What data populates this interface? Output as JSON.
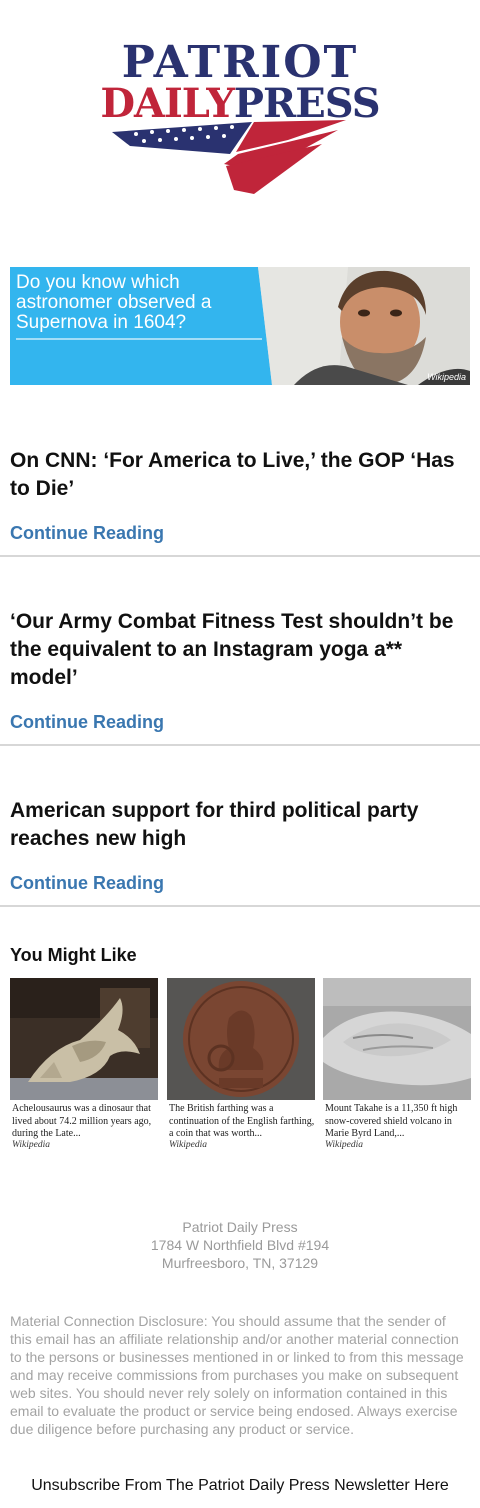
{
  "header": {
    "logo_line1": "PATRIOT",
    "logo_daily": "DAILY",
    "logo_press": "PRESS",
    "brand_colors": {
      "navy": "#2a3270",
      "red": "#c0253a"
    }
  },
  "ad": {
    "text": "Do you know which astronomer observed a Supernova in 1604?",
    "source": "Wikipedia",
    "background": "#33b5ee"
  },
  "articles": [
    {
      "title": "On CNN: ‘For America to Live,’ the GOP ‘Has to Die’",
      "cta": "Continue Reading"
    },
    {
      "title": "‘Our Army Combat Fitness Test shouldn’t be the equivalent to an Instagram yoga a** model’",
      "cta": "Continue Reading"
    },
    {
      "title": "American support for third political party reaches new high",
      "cta": "Continue Reading"
    }
  ],
  "you_might_like": {
    "title": "You Might Like",
    "cards": [
      {
        "caption": "Achelousaurus was a dinosaur that lived about 74.2 million years ago, during the Late...",
        "source": "Wikipedia",
        "icon": "dinosaur-skull-photo"
      },
      {
        "caption": "The British farthing was a continuation of the English farthing, a coin that was worth...",
        "source": "Wikipedia",
        "icon": "farthing-coin-photo"
      },
      {
        "caption": "Mount Takahe is a 11,350 ft high snow-covered shield volcano in Marie Byrd Land,...",
        "source": "Wikipedia",
        "icon": "volcano-aerial-photo"
      }
    ]
  },
  "footer": {
    "company": "Patriot Daily Press",
    "address1": "1784 W Northfield Blvd #194",
    "address2": "Murfreesboro, TN, 37129",
    "disclosure": "Material Connection Disclosure: You should assume that the sender of this email has an affiliate relationship and/or another material connection to the persons or businesses mentioned in or linked to from this message and may receive commissions from purchases you make on subsequent web sites. You should never rely solely on information contained in this email to evaluate the product or service being endosed. Always exercise due diligence before purchasing any product or service.",
    "unsubscribe": "Unsubscribe From The Patriot Daily Press Newsletter Here"
  }
}
